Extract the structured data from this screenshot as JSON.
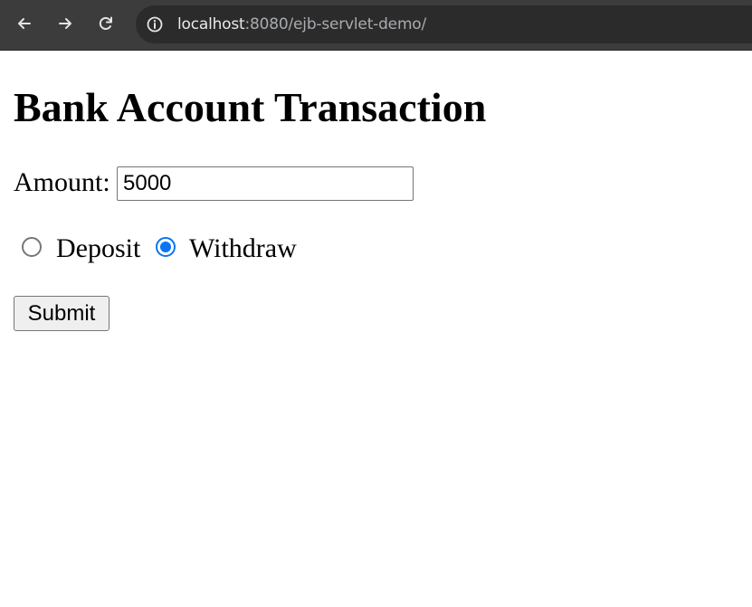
{
  "browser": {
    "url_host": "localhost",
    "url_rest": ":8080/ejb-servlet-demo/",
    "icons": {
      "back": "arrow-left-icon",
      "forward": "arrow-right-icon",
      "reload": "reload-icon",
      "site_info": "info-icon"
    }
  },
  "page": {
    "title": "Bank Account Transaction",
    "form": {
      "amount_label": "Amount:",
      "amount_value": "5000",
      "options": [
        {
          "label": "Deposit",
          "checked": false
        },
        {
          "label": "Withdraw",
          "checked": true
        }
      ],
      "submit_label": "Submit"
    }
  },
  "colors": {
    "toolbar_bg": "#3c3c3c",
    "omnibox_bg": "#2b2b2b",
    "radio_accent": "#0b74f4"
  }
}
